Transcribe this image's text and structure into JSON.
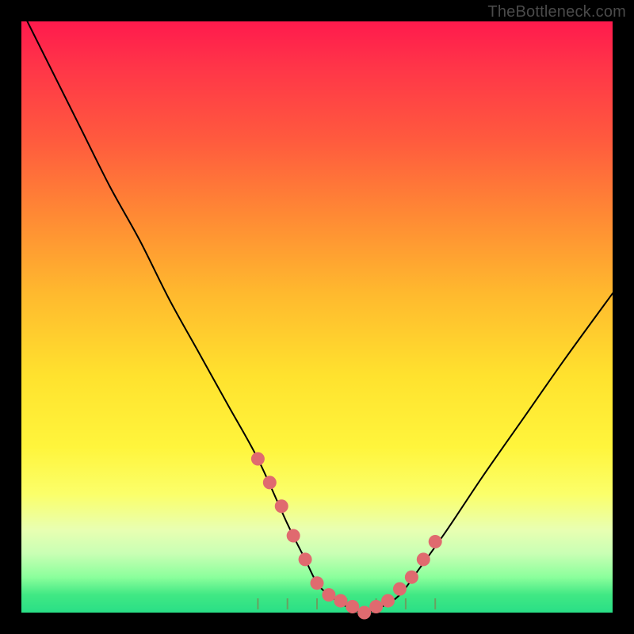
{
  "watermark": "TheBottleneck.com",
  "chart_data": {
    "type": "line",
    "title": "",
    "xlabel": "",
    "ylabel": "",
    "xlim": [
      0,
      100
    ],
    "ylim": [
      0,
      100
    ],
    "series": [
      {
        "name": "bottleneck-curve",
        "x": [
          0,
          5,
          10,
          15,
          20,
          25,
          30,
          35,
          40,
          45,
          48,
          50,
          52,
          55,
          58,
          61,
          64,
          67,
          72,
          78,
          85,
          92,
          100
        ],
        "y": [
          102,
          92,
          82,
          72,
          63,
          53,
          44,
          35,
          26,
          15,
          9,
          5,
          3,
          1,
          0,
          1,
          3,
          7,
          14,
          23,
          33,
          43,
          54
        ]
      }
    ],
    "highlight_dots": {
      "name": "highlight-dots",
      "x": [
        40,
        42,
        44,
        46,
        48,
        50,
        52,
        54,
        56,
        58,
        60,
        62,
        64,
        66,
        68,
        70
      ],
      "y": [
        26,
        22,
        18,
        13,
        9,
        5,
        3,
        2,
        1,
        0,
        1,
        2,
        4,
        6,
        9,
        12
      ]
    },
    "axis_ticks_x": [
      40,
      45,
      50,
      55,
      60,
      65,
      70
    ]
  }
}
